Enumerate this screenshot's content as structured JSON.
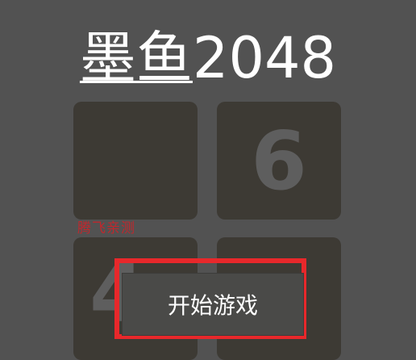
{
  "title": {
    "part1": "墨鱼",
    "part2": "2048"
  },
  "tiles": {
    "top_left": "",
    "top_right": "6",
    "bottom_left": "4",
    "bottom_right": ""
  },
  "watermark": "腾飞亲测",
  "start_button": "开始游戏",
  "colors": {
    "background": "#525252",
    "tile": "#3d3a34",
    "tile_number": "#5e5e5e",
    "highlight": "#e8282b",
    "watermark": "#c0282d"
  }
}
